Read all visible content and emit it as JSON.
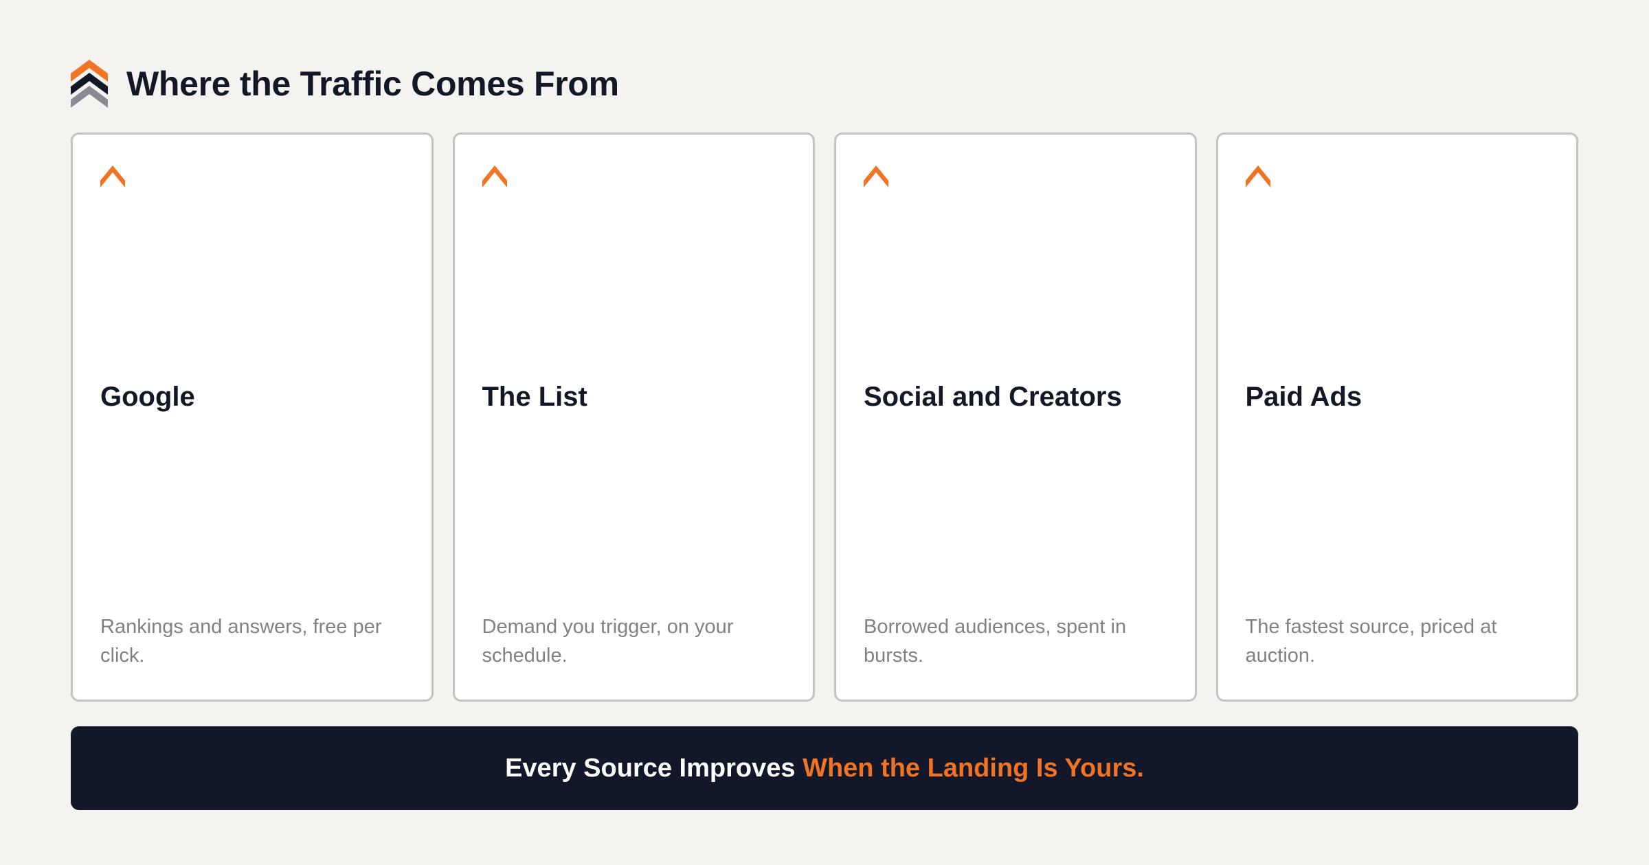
{
  "header": {
    "title": "Where the Traffic Comes From",
    "logo_icon": "stacked-chevrons-icon"
  },
  "cards": [
    {
      "icon": "chevron-up-icon",
      "title": "Google",
      "description": "Rankings and answers, free per click."
    },
    {
      "icon": "chevron-up-icon",
      "title": "The List",
      "description": "Demand you trigger, on your schedule."
    },
    {
      "icon": "chevron-up-icon",
      "title": "Social and Creators",
      "description": "Borrowed audiences, spent in bursts."
    },
    {
      "icon": "chevron-up-icon",
      "title": "Paid Ads",
      "description": "The fastest source, priced at auction."
    }
  ],
  "banner": {
    "text_plain": "Every Source Improves",
    "text_accent": "When the Landing Is Yours."
  },
  "colors": {
    "accent": "#f07423",
    "dark": "#121829",
    "background": "#f4f3f0",
    "card_border": "#c3c3c3",
    "muted_text": "#818181",
    "logo_gray": "#8a8a94"
  }
}
